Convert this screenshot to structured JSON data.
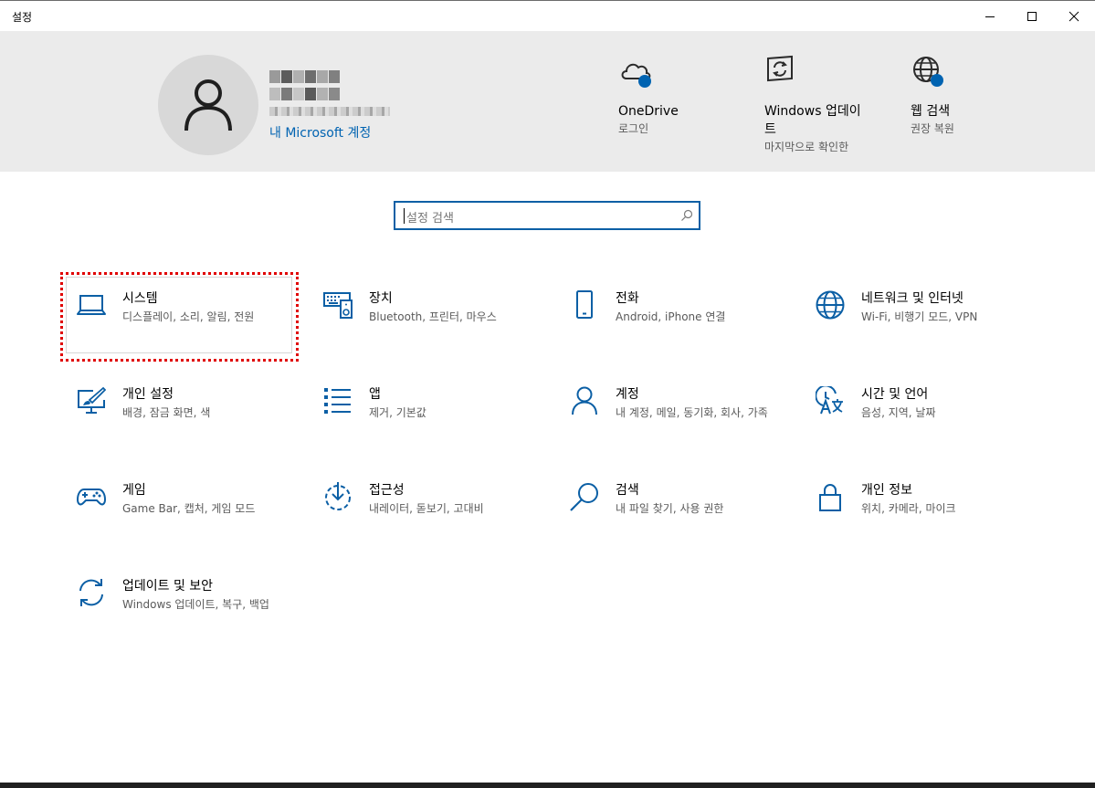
{
  "window": {
    "title": "설정"
  },
  "profile": {
    "account_link": "내 Microsoft 계정"
  },
  "quick_links": [
    {
      "title": "OneDrive",
      "subtitle": "로그인",
      "icon": "onedrive-cloud-icon"
    },
    {
      "title": "Windows 업데이트",
      "subtitle": "마지막으로 확인한",
      "icon": "windows-update-icon"
    },
    {
      "title": "웹 검색",
      "subtitle": "권장 복원",
      "icon": "web-search-globe-icon"
    }
  ],
  "search": {
    "placeholder": "설정 검색"
  },
  "tiles": [
    {
      "name": "시스템",
      "desc": "디스플레이, 소리, 알림, 전원",
      "icon": "laptop-icon"
    },
    {
      "name": "장치",
      "desc": "Bluetooth, 프린터, 마우스",
      "icon": "keyboard-speaker-icon"
    },
    {
      "name": "전화",
      "desc": "Android, iPhone 연결",
      "icon": "phone-icon"
    },
    {
      "name": "네트워크 및 인터넷",
      "desc": "Wi-Fi, 비행기 모드, VPN",
      "icon": "globe-icon"
    },
    {
      "name": "개인 설정",
      "desc": "배경, 잠금 화면, 색",
      "icon": "paint-brush-monitor-icon"
    },
    {
      "name": "앱",
      "desc": "제거, 기본값",
      "icon": "apps-list-icon"
    },
    {
      "name": "계정",
      "desc": "내 계정, 메일, 동기화, 회사, 가족",
      "icon": "person-icon"
    },
    {
      "name": "시간 및 언어",
      "desc": "음성, 지역, 날짜",
      "icon": "time-language-icon"
    },
    {
      "name": "게임",
      "desc": "Game Bar, 캡처, 게임 모드",
      "icon": "gamepad-icon"
    },
    {
      "name": "접근성",
      "desc": "내레이터, 돋보기, 고대비",
      "icon": "ease-of-access-icon"
    },
    {
      "name": "검색",
      "desc": "내 파일 찾기, 사용 권한",
      "icon": "search-icon"
    },
    {
      "name": "개인 정보",
      "desc": "위치, 카메라, 마이크",
      "icon": "lock-icon"
    },
    {
      "name": "업데이트 및 보안",
      "desc": "Windows 업데이트, 복구, 백업",
      "icon": "sync-arrows-icon"
    }
  ],
  "colors": {
    "accent": "#0063b1",
    "icon": "#0b5fa5",
    "header_bg": "#ebebeb",
    "highlight": "#e00000"
  }
}
